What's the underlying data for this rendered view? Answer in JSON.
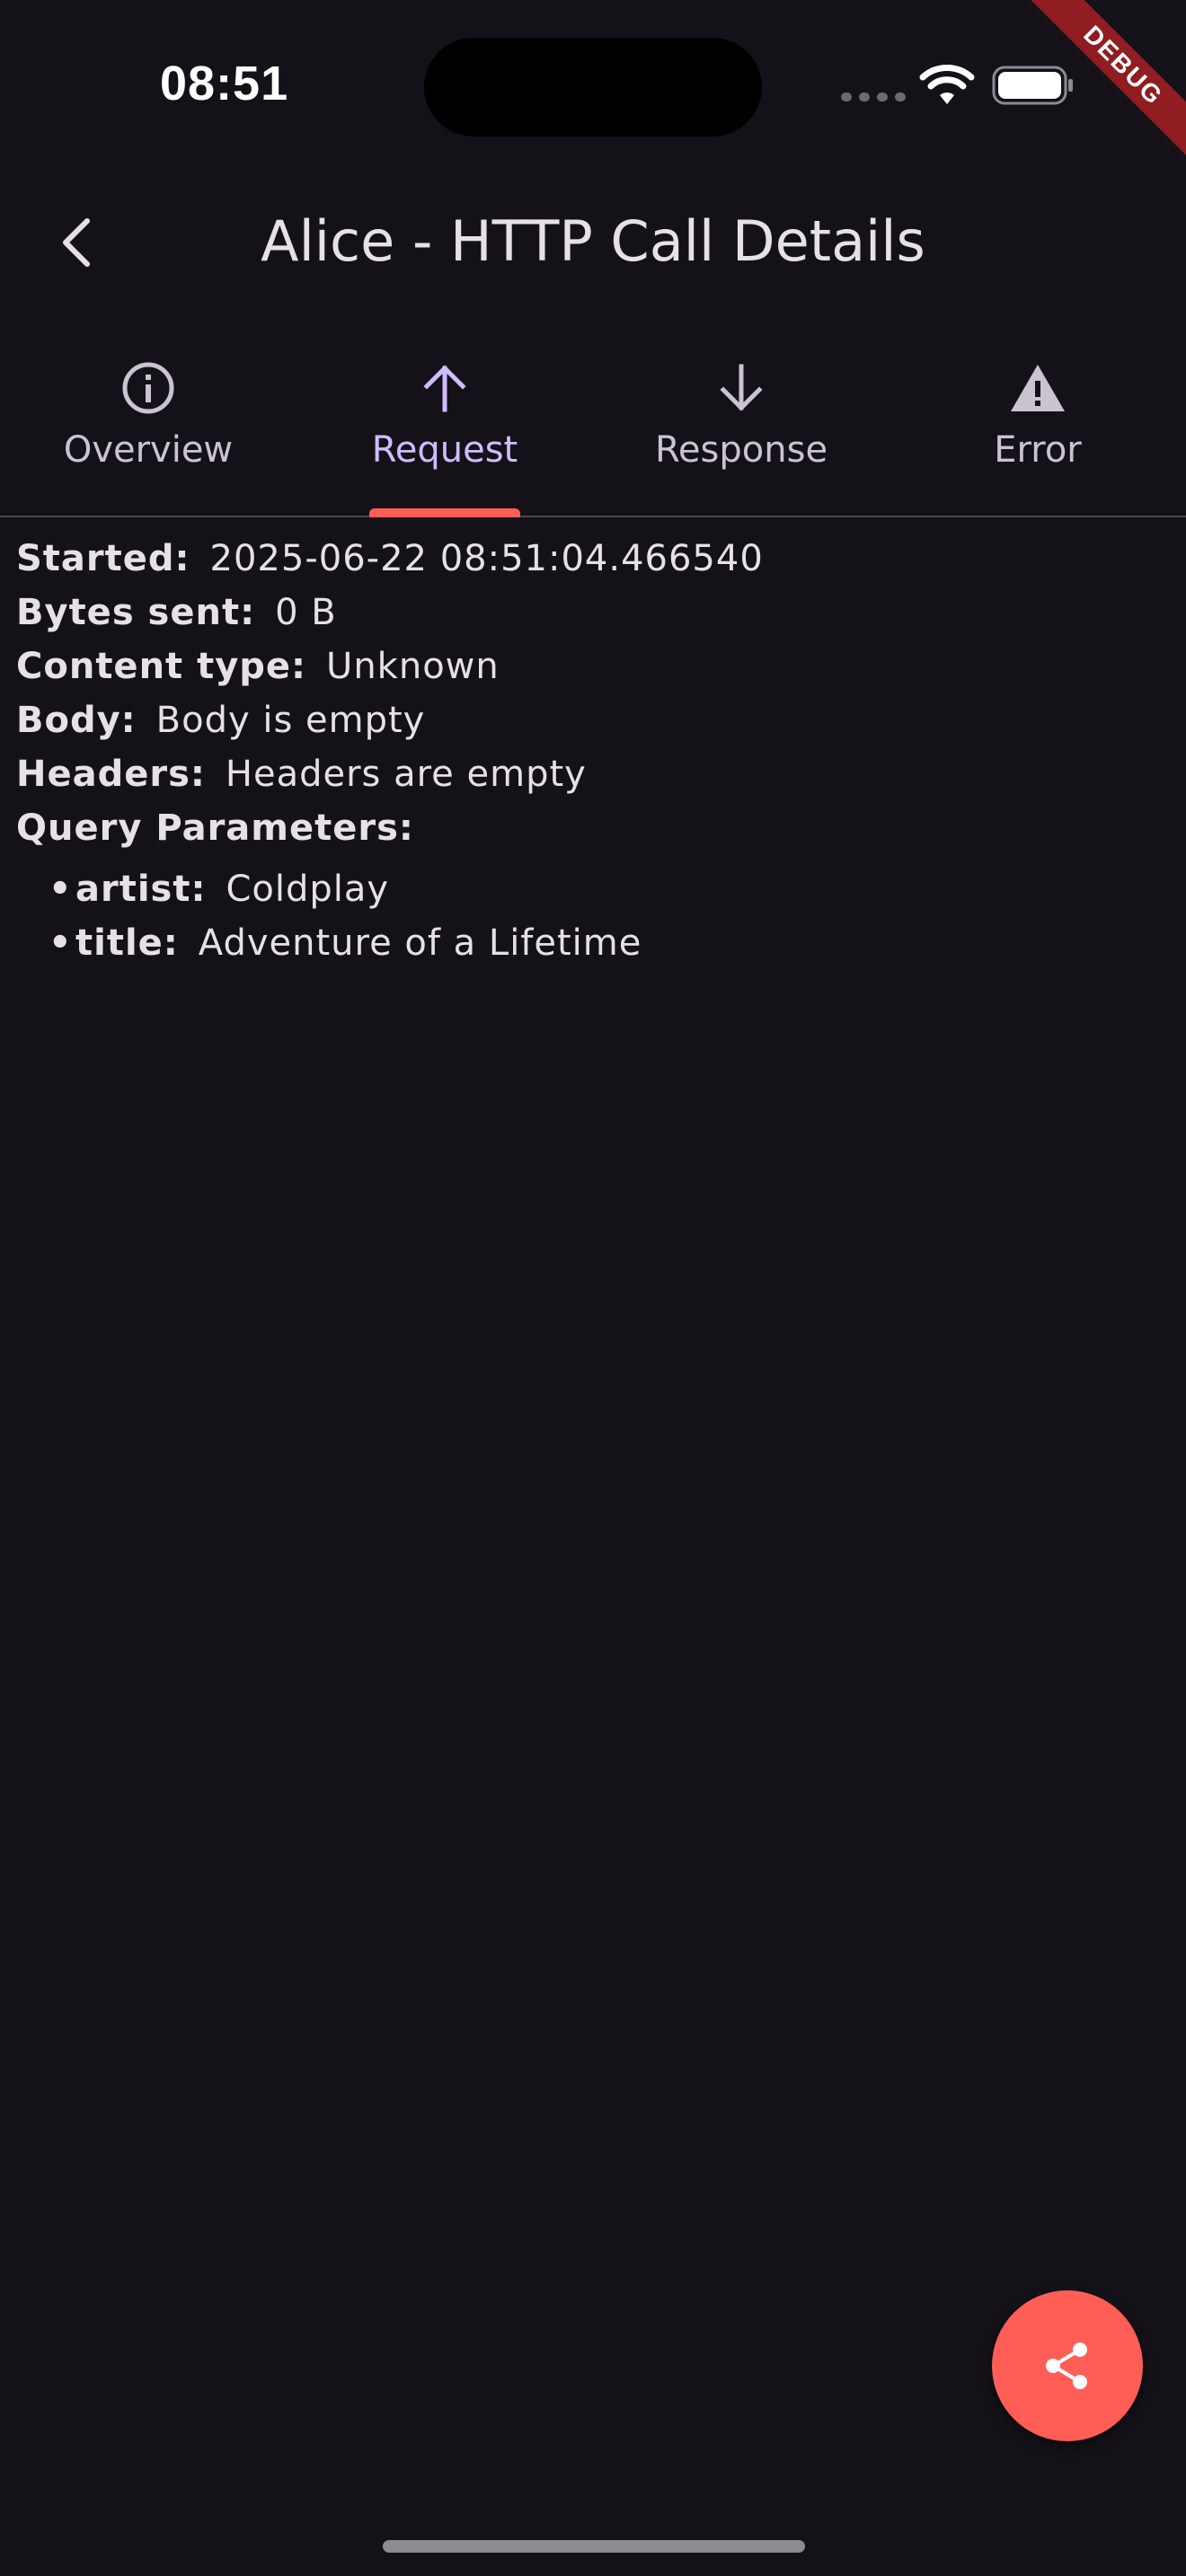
{
  "status_bar": {
    "time": "08:51"
  },
  "debug_banner": "DEBUG",
  "app_bar": {
    "title": "Alice - HTTP Call Details",
    "back_icon": "chevron-left-icon"
  },
  "tabs": [
    {
      "label": "Overview",
      "icon": "info-icon",
      "active": false
    },
    {
      "label": "Request",
      "icon": "arrow-up-icon",
      "active": true
    },
    {
      "label": "Response",
      "icon": "arrow-down-icon",
      "active": false
    },
    {
      "label": "Error",
      "icon": "warning-icon",
      "active": false
    }
  ],
  "request": {
    "started_label": "Started:",
    "started_value": "2025-06-22 08:51:04.466540",
    "bytes_label": "Bytes sent:",
    "bytes_value": "0 B",
    "content_type_label": "Content type:",
    "content_type_value": "Unknown",
    "body_label": "Body:",
    "body_value": "Body is empty",
    "headers_label": "Headers:",
    "headers_value": "Headers are empty",
    "query_label": "Query Parameters:",
    "query_params": [
      {
        "key": "artist:",
        "value": "Coldplay"
      },
      {
        "key": "title:",
        "value": "Adventure of a Lifetime"
      }
    ]
  },
  "fab": {
    "icon": "share-icon"
  },
  "colors": {
    "background": "#141218",
    "accent": "#d0bcff",
    "indicator": "#ff5e57",
    "fab": "#ff5e57"
  }
}
